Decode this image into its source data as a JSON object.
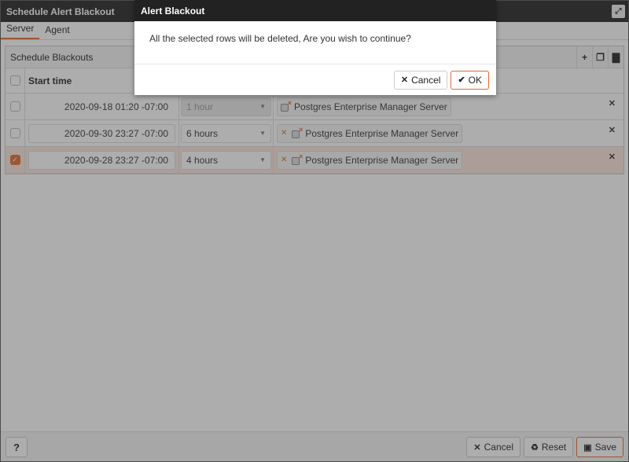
{
  "window": {
    "title": "Schedule Alert Blackout",
    "maximize_icon": "expand-icon"
  },
  "tabs": [
    {
      "label": "Server",
      "active": true
    },
    {
      "label": "Agent",
      "active": false
    }
  ],
  "panel": {
    "title": "Schedule Blackouts",
    "add_icon": "+",
    "copy_icon": "❐",
    "delete_icon": "🗑"
  },
  "grid": {
    "columns": [
      "Start time"
    ],
    "rows": [
      {
        "selected": false,
        "start_time": "2020-09-18 01:20 -07:00",
        "duration": "1 hour",
        "server": "Postgres Enterprise Manager Server",
        "editable": false
      },
      {
        "selected": false,
        "start_time": "2020-09-30 23:27 -07:00",
        "duration": "6 hours",
        "server": "Postgres Enterprise Manager Server",
        "editable": true
      },
      {
        "selected": true,
        "start_time": "2020-09-28 23:27 -07:00",
        "duration": "4 hours",
        "server": "Postgres Enterprise Manager Server",
        "editable": true
      }
    ]
  },
  "footer": {
    "help_label": "?",
    "cancel_label": "Cancel",
    "reset_label": "Reset",
    "save_label": "Save"
  },
  "dialog": {
    "title": "Alert Blackout",
    "message": "All the selected rows will be deleted, Are you wish to continue?",
    "cancel_label": "Cancel",
    "ok_label": "OK"
  },
  "colors": {
    "accent": "#e06a2f",
    "titlebar": "#222222"
  }
}
